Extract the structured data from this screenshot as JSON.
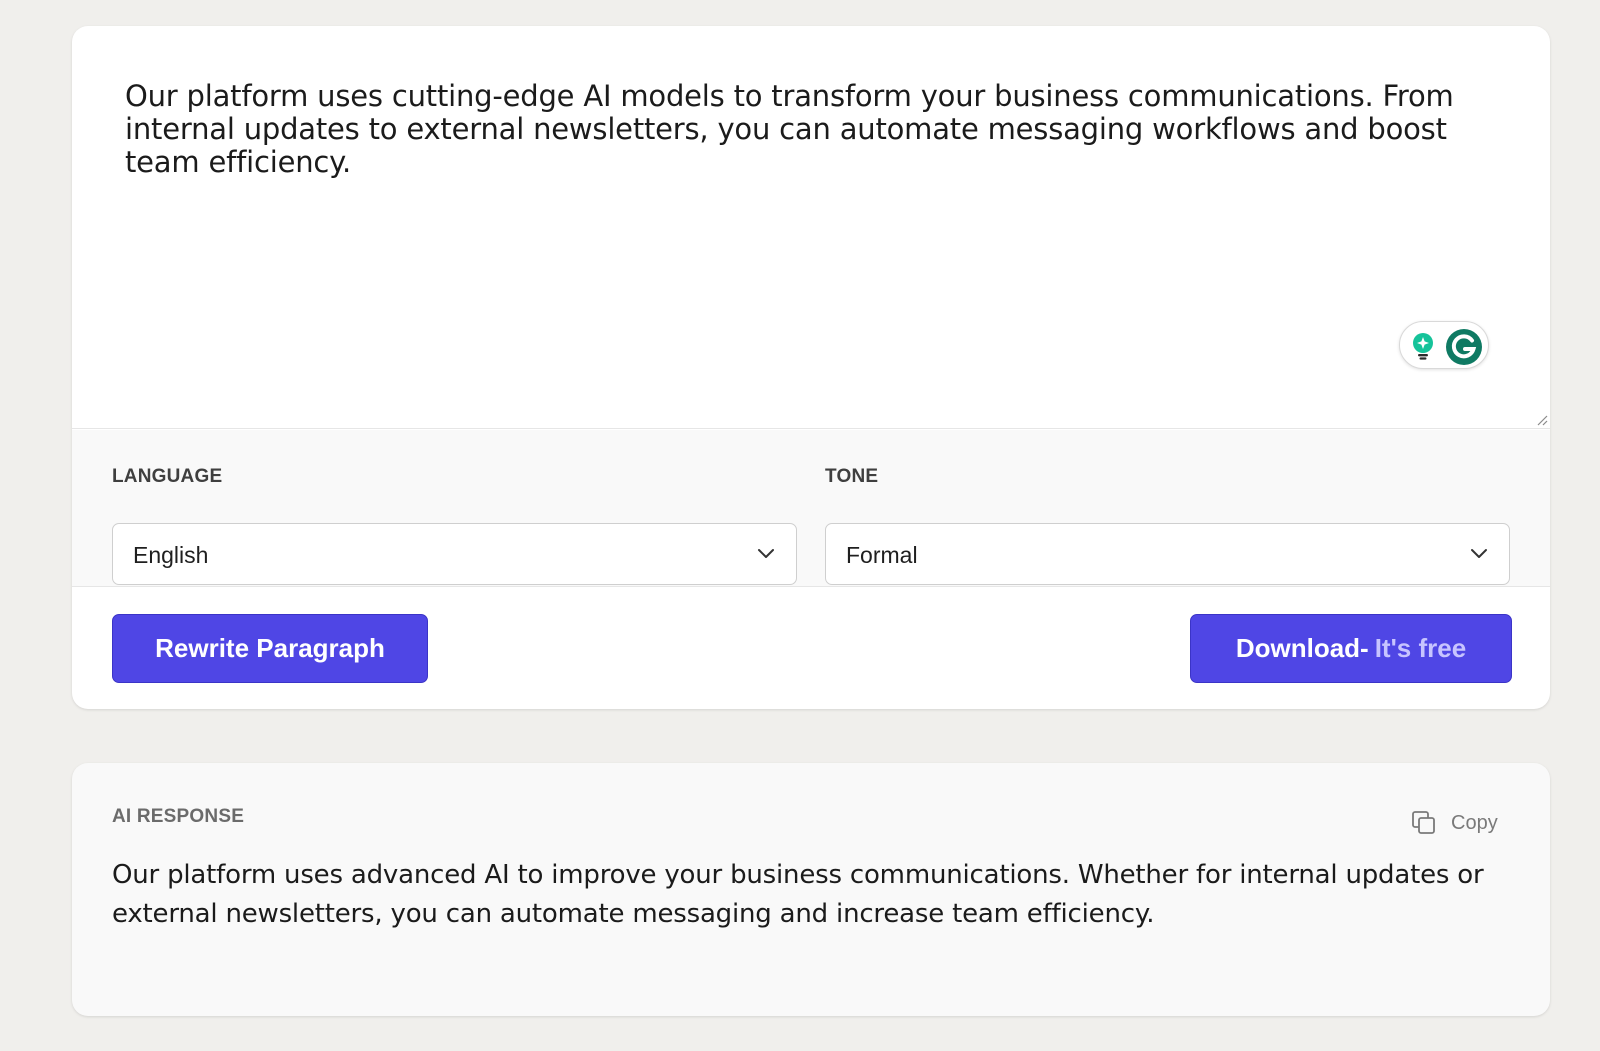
{
  "editor": {
    "text": "Our platform uses cutting-edge AI models to transform your business communications. From internal updates to external newsletters, you can automate messaging workflows and boost team efficiency."
  },
  "settings": {
    "language": {
      "label": "LANGUAGE",
      "value": "English"
    },
    "tone": {
      "label": "TONE",
      "value": "Formal"
    }
  },
  "actions": {
    "rewrite_label": "Rewrite Paragraph",
    "download_label": "Download-",
    "download_accent": "It's free"
  },
  "response": {
    "label": "AI RESPONSE",
    "copy_label": "Copy",
    "text": "Our platform uses advanced AI to improve your business communications. Whether for internal updates or external newsletters, you can automate messaging and increase team efficiency."
  },
  "colors": {
    "page_bg": "#f0efec",
    "accent": "#4f46e5",
    "grammarly": "#0f7a63"
  }
}
